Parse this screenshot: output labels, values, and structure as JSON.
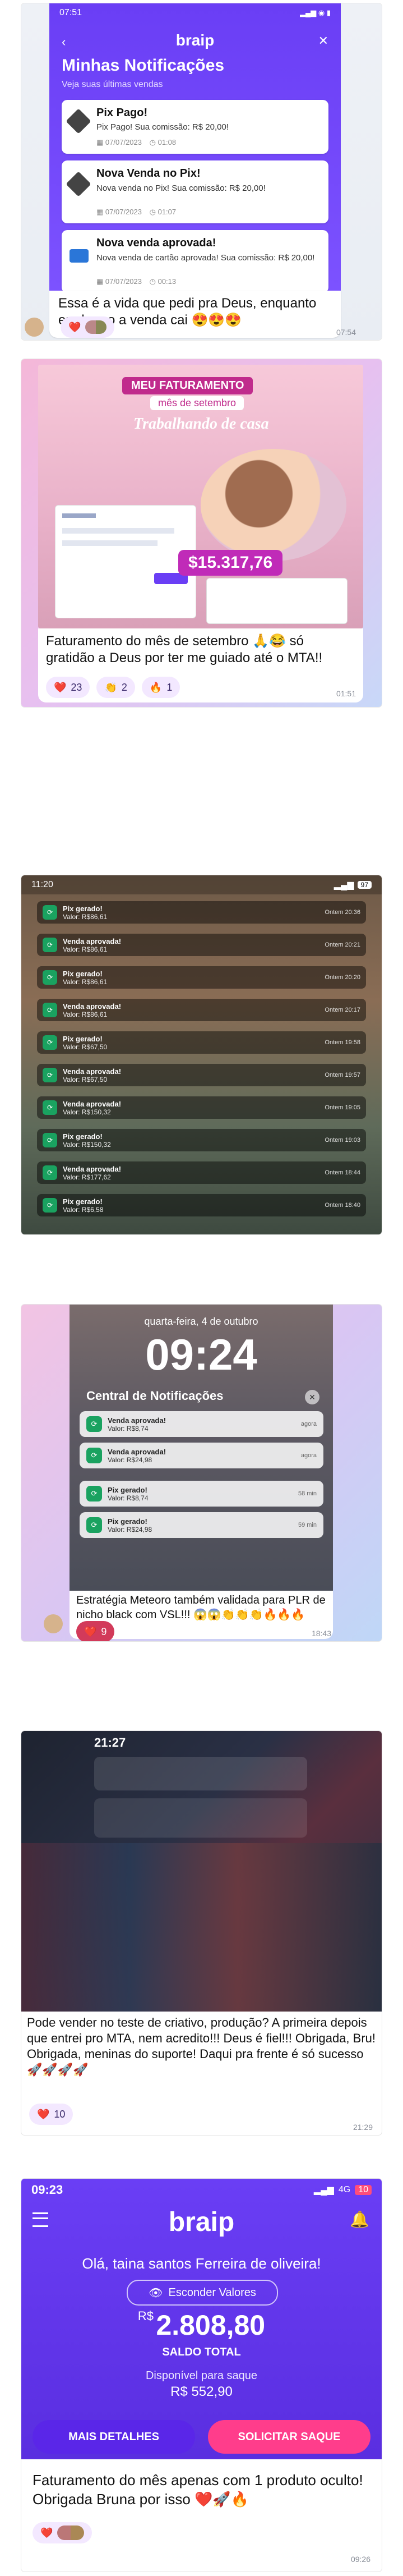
{
  "post1": {
    "statusbar_time": "07:51",
    "brand": "braip",
    "header_title": "Minhas Notificações",
    "header_subtitle": "Veja suas últimas vendas",
    "notifications": [
      {
        "title": "Pix Pago!",
        "body": "Pix Pago! Sua comissão: R$ 20,00!",
        "date": "07/07/2023",
        "time": "01:08"
      },
      {
        "title": "Nova Venda no Pix!",
        "body": "Nova venda no Pix! Sua comissão: R$ 20,00!",
        "date": "07/07/2023",
        "time": "01:07"
      },
      {
        "title": "Nova venda aprovada!",
        "body": "Nova venda de cartão aprovada! Sua comissão: R$ 20,00!",
        "date": "07/07/2023",
        "time": "00:13"
      }
    ],
    "caption": "Essa é a vida que pedi pra Deus, enquanto eu durmo a venda cai 😍😍😍",
    "reaction_count": "",
    "timestamp": "07:54"
  },
  "post2": {
    "banner_top": "MEU FATURAMENTO",
    "banner_sub": "mês de setembro",
    "banner_script": "Trabalhando de casa",
    "amount": "$15.317,76",
    "caption": "Faturamento do mês de setembro 🙏😂 só gratidão a Deus por ter me guiado até o MTA!!",
    "reactions": [
      {
        "emoji": "❤️",
        "count": "23"
      },
      {
        "emoji": "👏",
        "count": "2"
      },
      {
        "emoji": "🔥",
        "count": "1"
      }
    ],
    "timestamp": "01:51"
  },
  "post3": {
    "statusbar_time": "11:20",
    "battery": "97",
    "notifications": [
      {
        "title": "Pix gerado!",
        "body": "Valor: R$86,61",
        "time": "Ontem 20:36"
      },
      {
        "title": "Venda aprovada!",
        "body": "Valor: R$86,61",
        "time": "Ontem 20:21"
      },
      {
        "title": "Pix gerado!",
        "body": "Valor: R$86,61",
        "time": "Ontem 20:20"
      },
      {
        "title": "Venda aprovada!",
        "body": "Valor: R$86,61",
        "time": "Ontem 20:17"
      },
      {
        "title": "Pix gerado!",
        "body": "Valor: R$67,50",
        "time": "Ontem 19:58"
      },
      {
        "title": "Venda aprovada!",
        "body": "Valor: R$67,50",
        "time": "Ontem 19:57"
      },
      {
        "title": "Venda aprovada!",
        "body": "Valor: R$150,32",
        "time": "Ontem 19:05"
      },
      {
        "title": "Pix gerado!",
        "body": "Valor: R$150,32",
        "time": "Ontem 19:03"
      },
      {
        "title": "Venda aprovada!",
        "body": "Valor: R$177,62",
        "time": "Ontem 18:44"
      },
      {
        "title": "Pix gerado!",
        "body": "Valor: R$6,58",
        "time": "Ontem 18:40"
      }
    ]
  },
  "post4": {
    "date": "quarta-feira, 4 de outubro",
    "clock": "09:24",
    "center_title": "Central de Notificações",
    "notifications": [
      {
        "title": "Venda aprovada!",
        "body": "Valor: R$8,74",
        "time": "agora"
      },
      {
        "title": "Venda aprovada!",
        "body": "Valor: R$24,98",
        "time": "agora"
      },
      {
        "title": "Pix gerado!",
        "body": "Valor: R$8,74",
        "time": "58 min"
      },
      {
        "title": "Pix gerado!",
        "body": "Valor: R$24,98",
        "time": "59 min"
      }
    ],
    "caption": "Estratégia Meteoro também validada para PLR de nicho black com VSL!!! 😱😱👏👏👏🔥🔥🔥",
    "reaction_count": "9",
    "timestamp": "18:43"
  },
  "post5": {
    "statusbar_time": "21:27",
    "caption": "Pode vender no teste de criativo, produção? A primeira depois que entrei pro MTA, nem acredito!!! Deus é fiel!!! Obrigada, Bru! Obrigada, meninas do suporte! Daqui pra frente é só sucesso 🚀🚀🚀🚀",
    "reaction_count": "10",
    "timestamp": "21:29"
  },
  "post6": {
    "statusbar_time": "09:23",
    "network": "4G",
    "battery": "10",
    "brand": "braip",
    "greeting": "Olá, taina santos Ferreira de oliveira!",
    "hide_values_label": "Esconder Valores",
    "currency": "R$",
    "total_value": "2.808,80",
    "total_label": "SALDO TOTAL",
    "available_label": "Disponível para saque",
    "available_value": "R$ 552,90",
    "details_button": "MAIS DETALHES",
    "withdraw_button": "SOLICITAR SAQUE",
    "caption": "Faturamento do mês apenas com 1 produto oculto! Obrigada Bruna por isso ❤️🚀🔥",
    "timestamp": "09:26"
  },
  "colors": {
    "brand_purple": "#6a3ef5",
    "brand_purple_dark": "#4a22c9",
    "pink_button": "#ff3d8b",
    "accent_green": "#1aa260"
  }
}
